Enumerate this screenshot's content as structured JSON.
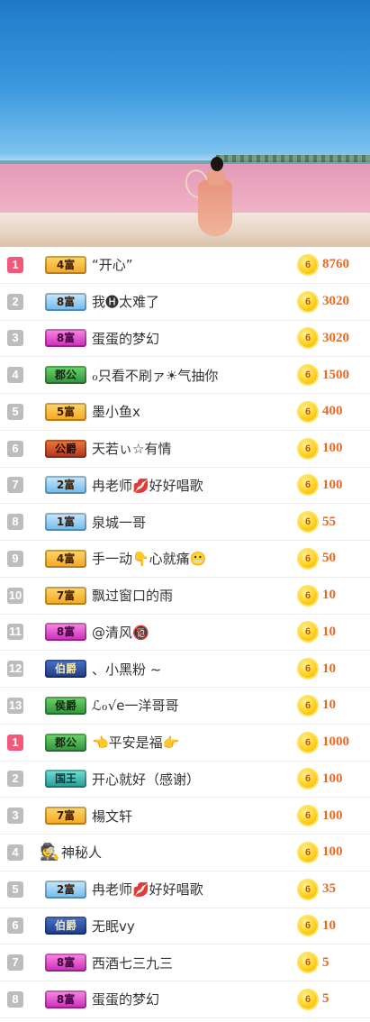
{
  "hero": {
    "image": "pink-lake-beach-photo"
  },
  "rows": [
    {
      "rank": "1",
      "rank_style": "top",
      "badge": "4富",
      "badge_style": "gold",
      "name": "“开心”",
      "amount": "8760"
    },
    {
      "rank": "2",
      "rank_style": "",
      "badge": "8富",
      "badge_style": "blue",
      "name": "我🅗太难了",
      "amount": "3020"
    },
    {
      "rank": "3",
      "rank_style": "",
      "badge": "8富",
      "badge_style": "pink",
      "name": "蛋蛋的梦幻",
      "amount": "3020"
    },
    {
      "rank": "4",
      "rank_style": "",
      "badge": "郡公",
      "badge_style": "green",
      "name": "ℴ只看不刷ァ☀气抽你",
      "amount": "1500"
    },
    {
      "rank": "5",
      "rank_style": "",
      "badge": "5富",
      "badge_style": "gold",
      "name": "墨小鱼x",
      "amount": "400"
    },
    {
      "rank": "6",
      "rank_style": "",
      "badge": "公爵",
      "badge_style": "red",
      "name": "天若ぃ☆有情",
      "amount": "100"
    },
    {
      "rank": "7",
      "rank_style": "",
      "badge": "2富",
      "badge_style": "blue",
      "name": "冉老师💋好好唱歌",
      "amount": "100"
    },
    {
      "rank": "8",
      "rank_style": "",
      "badge": "1富",
      "badge_style": "blue",
      "name": "泉城一哥",
      "amount": "55"
    },
    {
      "rank": "9",
      "rank_style": "",
      "badge": "4富",
      "badge_style": "gold",
      "name": "手一动👇心就痛😬",
      "amount": "50"
    },
    {
      "rank": "10",
      "rank_style": "",
      "badge": "7富",
      "badge_style": "gold",
      "name": "飘过窗口的雨",
      "amount": "10"
    },
    {
      "rank": "11",
      "rank_style": "",
      "badge": "8富",
      "badge_style": "pink",
      "name": "@清风🔞",
      "amount": "10"
    },
    {
      "rank": "12",
      "rank_style": "",
      "badge": "伯爵",
      "badge_style": "navy",
      "name": "、小黑粉 ~",
      "amount": "10"
    },
    {
      "rank": "13",
      "rank_style": "",
      "badge": "侯爵",
      "badge_style": "green",
      "name": "ℒℴ√e一洋哥哥",
      "amount": "10"
    },
    {
      "rank": "1",
      "rank_style": "top",
      "badge": "郡公",
      "badge_style": "green",
      "name": "👈平安是福👉",
      "amount": "1000"
    },
    {
      "rank": "2",
      "rank_style": "",
      "badge": "国王",
      "badge_style": "teal",
      "name": "开心就好（感谢）",
      "amount": "100"
    },
    {
      "rank": "3",
      "rank_style": "",
      "badge": "7富",
      "badge_style": "gold",
      "name": "楊文轩",
      "amount": "100"
    },
    {
      "rank": "4",
      "rank_style": "",
      "badge": "",
      "badge_style": "anon",
      "name": "神秘人",
      "amount": "100"
    },
    {
      "rank": "5",
      "rank_style": "",
      "badge": "2富",
      "badge_style": "blue",
      "name": "冉老师💋好好唱歌",
      "amount": "35"
    },
    {
      "rank": "6",
      "rank_style": "",
      "badge": "伯爵",
      "badge_style": "navy",
      "name": "无眠vy",
      "amount": "10"
    },
    {
      "rank": "7",
      "rank_style": "",
      "badge": "8富",
      "badge_style": "pink",
      "name": "西酒七三九三",
      "amount": "5"
    },
    {
      "rank": "8",
      "rank_style": "",
      "badge": "8富",
      "badge_style": "pink",
      "name": "蛋蛋的梦幻",
      "amount": "5"
    }
  ],
  "coin_label": "6",
  "anon_icon": "spy-avatar-icon",
  "colors": {
    "top_rank": "#f0597a",
    "rank": "#bdbdbd",
    "amount": "#e86a22",
    "coin": "#ffd21f"
  }
}
